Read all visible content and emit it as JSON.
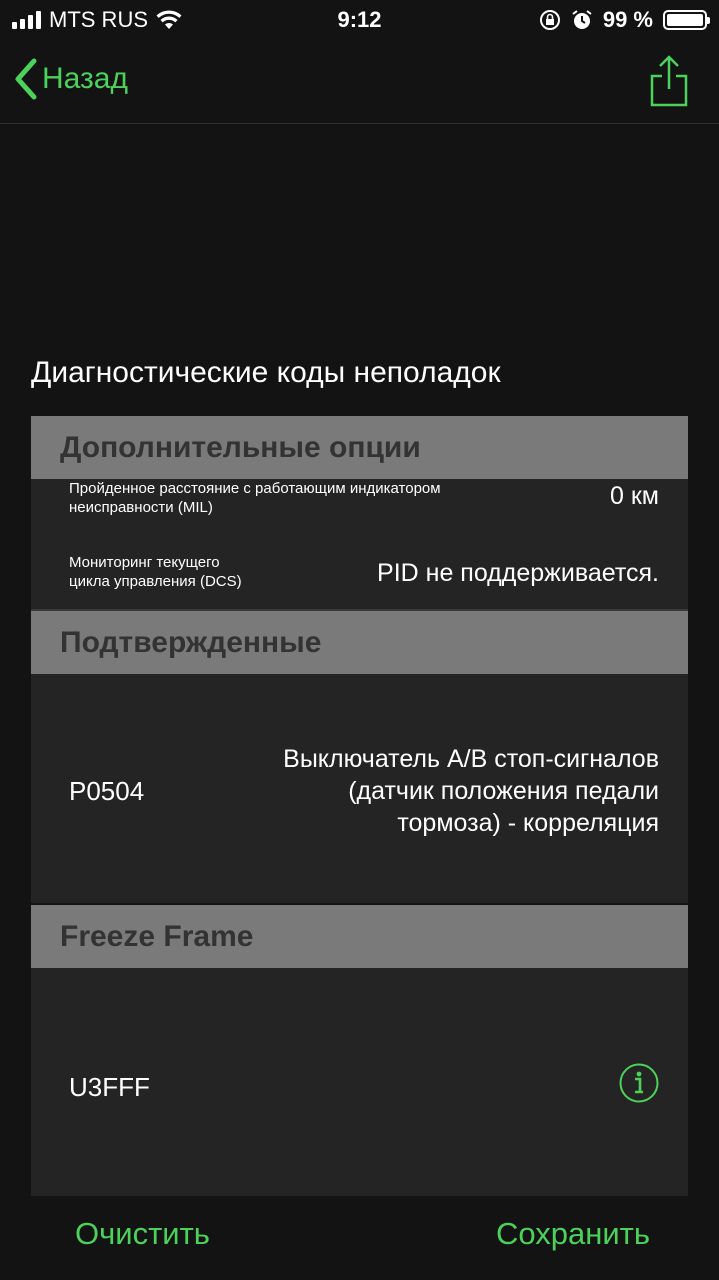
{
  "status_bar": {
    "carrier": "MTS RUS",
    "time": "9:12",
    "battery_percent": "99 %",
    "battery_level": 0.99,
    "icons": [
      "signal-icon",
      "wifi-icon",
      "orientation-lock-icon",
      "alarm-icon",
      "battery-icon"
    ]
  },
  "nav": {
    "back_label": "Назад",
    "back_icon": "chevron-left-icon",
    "share_icon": "share-icon"
  },
  "colors": {
    "accent": "#4cd15a",
    "background": "#131313",
    "row_bg": "#242424",
    "section_header_bg": "#7a7a7a",
    "section_header_text": "#333333"
  },
  "page_title": "Диагностические коды неполадок",
  "sections": {
    "additional": {
      "header": "Дополнительные опции",
      "rows": [
        {
          "label_line1": "Пройденное расстояние с работающим индикатором",
          "label_line2": "неисправности (MIL)",
          "value": "0 км"
        },
        {
          "label_line1": "Мониторинг текущего",
          "label_line2": "цикла управления (DCS)",
          "value": "PID не поддерживается."
        }
      ]
    },
    "confirmed": {
      "header": "Подтвержденные",
      "rows": [
        {
          "code": "P0504",
          "desc_line1": "Выключатель A/B стоп-сигналов",
          "desc_line2": "(датчик положения педали",
          "desc_line3": "тормоза) - корреляция"
        }
      ]
    },
    "freeze_frame": {
      "header": "Freeze Frame",
      "rows": [
        {
          "code": "U3FFF",
          "icon": "info-icon"
        }
      ]
    }
  },
  "toolbar": {
    "clear_label": "Очистить",
    "save_label": "Сохранить"
  }
}
